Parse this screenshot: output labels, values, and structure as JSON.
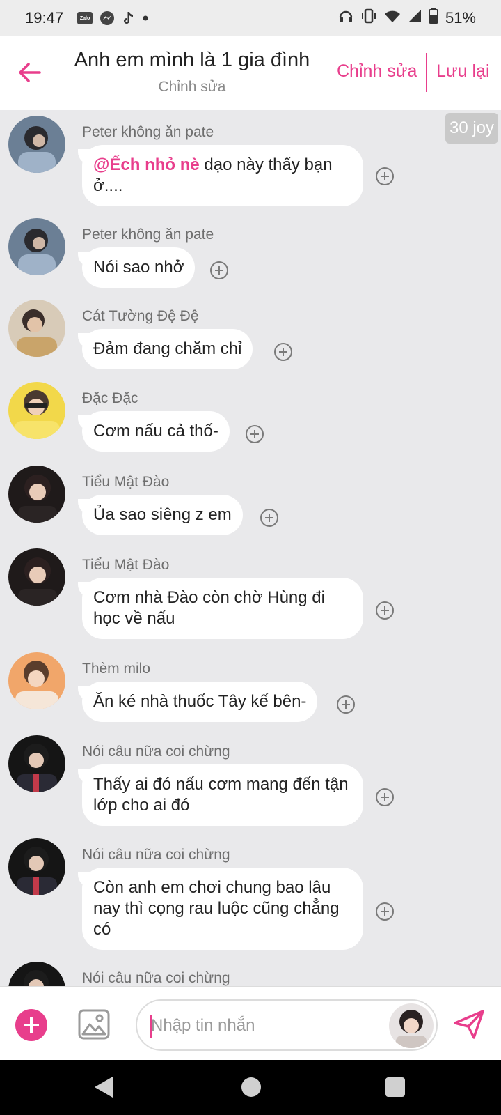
{
  "status_bar": {
    "time": "19:47",
    "notification_icons": [
      "zalo-icon",
      "messenger-icon",
      "tiktok-icon",
      "dot-icon"
    ],
    "system_icons": [
      "headphones-icon",
      "vibrate-icon",
      "wifi-icon",
      "signal-icon",
      "battery-icon"
    ],
    "battery": "51%"
  },
  "header": {
    "title": "Anh em mình là 1 gia đình",
    "subtitle": "Chỉnh sửa",
    "edit_label": "Chỉnh sửa",
    "save_label": "Lưu lại",
    "accent_color": "#e83e8c"
  },
  "badge": {
    "label": "30 joy"
  },
  "messages": [
    {
      "sender": "Peter không ăn pate",
      "mention": "@Ếch nhỏ nè",
      "text": " dạo này thấy bạn ở...."
    },
    {
      "sender": "Peter không ăn pate",
      "text": "Nói sao nhở"
    },
    {
      "sender": "Cát Tường Đệ Đệ",
      "text": "Đảm đang chăm chỉ"
    },
    {
      "sender": "Đặc Đặc",
      "text": "Cơm nấu cả thố-"
    },
    {
      "sender": "Tiểu Mật Đào",
      "text": "Ủa sao siêng z em"
    },
    {
      "sender": "Tiểu Mật Đào",
      "text": "Cơm nhà Đào còn chờ Hùng đi học về nấu"
    },
    {
      "sender": "Thèm milo",
      "text": "Ăn ké nhà thuốc Tây kế bên-"
    },
    {
      "sender": "Nói câu nữa coi chừng",
      "text": "Thấy ai đó nấu cơm mang đến tận lớp cho ai đó"
    },
    {
      "sender": "Nói câu nữa coi chừng",
      "text": "Còn anh em chơi chung bao lâu nay thì cọng rau luộc cũng chẳng có"
    },
    {
      "sender": "Nói câu nữa coi chừng",
      "text": ""
    }
  ],
  "composer": {
    "placeholder": "Nhập tin nhắn",
    "plus_icon": "plus-icon",
    "image_icon": "image-icon",
    "send_icon": "send-icon"
  },
  "nav": [
    "back-icon",
    "home-icon",
    "recents-icon"
  ]
}
